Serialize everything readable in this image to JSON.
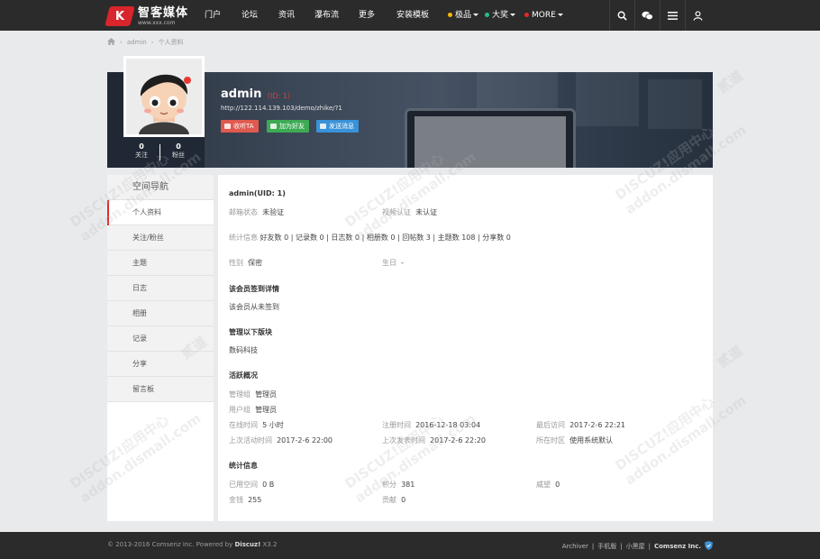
{
  "header": {
    "logo_mark": "K",
    "logo_title": "智客媒体",
    "logo_sub": "www.xxx.com",
    "nav": [
      "门户",
      "论坛",
      "资讯",
      "瀑布流",
      "更多",
      "安装模板"
    ],
    "dropdowns": [
      {
        "label": "极品",
        "color": "#f5b800"
      },
      {
        "label": "大奖",
        "color": "#1fbf8f"
      },
      {
        "label": "MORE",
        "color": "#e02a2a"
      }
    ]
  },
  "breadcrumb": [
    "admin",
    "个人资料"
  ],
  "profile": {
    "name": "admin",
    "id_text": "（ID: 1）",
    "url": "http://122.114.139.103/demo/zhike/?1",
    "buttons": [
      {
        "label": "收听TA",
        "color": "#e05a4f"
      },
      {
        "label": "加为好友",
        "color": "#3dab54"
      },
      {
        "label": "发送消息",
        "color": "#3a92d8"
      }
    ],
    "stats": [
      {
        "num": "0",
        "label": "关注"
      },
      {
        "num": "0",
        "label": "粉丝"
      }
    ]
  },
  "sidenav": {
    "title": "空间导航",
    "items": [
      "个人资料",
      "关注/粉丝",
      "主题",
      "日志",
      "相册",
      "记录",
      "分享",
      "留言板"
    ]
  },
  "main": {
    "uid": "admin(UID: 1)",
    "email_label": "邮箱状态",
    "email_value": "未验证",
    "video_label": "视频认证",
    "video_value": "未认证",
    "counts_label": "统计信息",
    "counts": [
      "好友数 0",
      "记录数 0",
      "日志数 0",
      "相册数 0",
      "回帖数 3",
      "主题数 108",
      "分享数 0"
    ],
    "gender_label": "性别",
    "gender_value": "保密",
    "birthday_label": "生日",
    "birthday_value": "-",
    "checkin_title": "该会员签到详情",
    "checkin_text": "该会员从未签到",
    "manage_title": "管理以下版块",
    "manage_text": "数码科技",
    "activity_title": "活跃概况",
    "admin_group_label": "管理组",
    "admin_group_value": "管理员",
    "user_group_label": "用户组",
    "user_group_value": "管理员",
    "online_label": "在线时间",
    "online_value": "5 小时",
    "reg_label": "注册时间",
    "reg_value": "2016-12-18 03:04",
    "last_visit_label": "最后访问",
    "last_visit_value": "2017-2-6 22:21",
    "last_active_label": "上次活动时间",
    "last_active_value": "2017-2-6 22:00",
    "last_post_label": "上次发表时间",
    "last_post_value": "2017-2-6 22:20",
    "tz_label": "所在时区",
    "tz_value": "使用系统默认",
    "stats_title": "统计信息",
    "space_label": "已用空间",
    "space_value": "0 B",
    "points_label": "积分",
    "points_value": "381",
    "prestige_label": "威望",
    "prestige_value": "0",
    "money_label": "金钱",
    "money_value": "255",
    "contrib_label": "贡献",
    "contrib_value": "0"
  },
  "footer": {
    "copyright": "© 2013-2016 Comsenz Inc. Powered by",
    "brand": "Discuz!",
    "version": "X3.2",
    "links": [
      "Archiver",
      "手机版",
      "小黑屋"
    ],
    "company": "Comsenz Inc."
  },
  "watermark": {
    "line1": "DISCUZ!应用中心",
    "line2": "addon.dismall.com",
    "tag": "贰道"
  }
}
